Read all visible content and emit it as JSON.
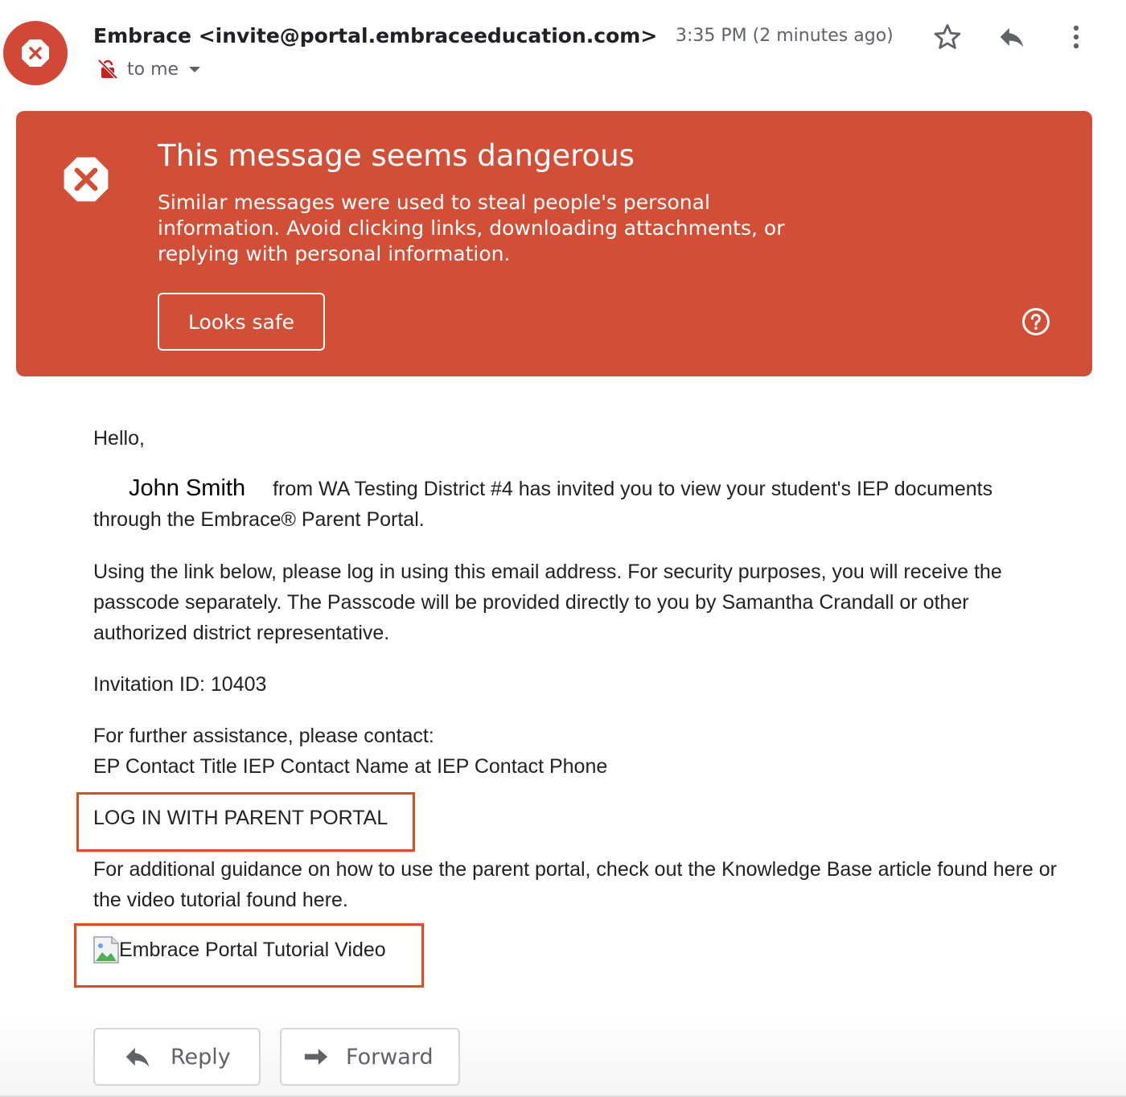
{
  "email": {
    "sender": "Embrace <invite@portal.embraceeducation.com>",
    "recipient": "to me",
    "timestamp": "3:35 PM (2 minutes ago)"
  },
  "warning": {
    "title": "This message seems dangerous",
    "body": "Similar messages were used to steal people's personal information. Avoid clicking links, downloading attachments, or replying with personal information.",
    "button": "Looks safe",
    "background_color": "#d14f37"
  },
  "body": {
    "greeting": "Hello,",
    "invite_name": "John Smith",
    "invite_text": "from WA Testing District #4 has invited you to view your student's IEP documents through the Embrace® Parent Portal.",
    "instructions": "Using the link below, please log in using this email address. For security purposes, you will receive the passcode separately. The Passcode will be provided directly to you by Samantha Crandall or other authorized district representative.",
    "invitation_id": "Invitation ID: 10403",
    "assistance_line1": "For further assistance, please contact:",
    "assistance_line2": "EP Contact Title IEP Contact Name at IEP Contact Phone",
    "portal_link": "LOG IN WITH PARENT PORTAL",
    "guidance": "For additional guidance on how to use the parent portal, check out the Knowledge Base article found here or the video tutorial found here.",
    "video_alt": "Embrace Portal Tutorial Video"
  },
  "actions": {
    "reply": "Reply",
    "forward": "Forward"
  },
  "colors": {
    "highlight_box": "#e8461c",
    "avatar": "#d14836"
  },
  "icons": [
    "danger-icon",
    "no-encryption-icon",
    "chevron-down-icon",
    "star-icon",
    "reply-icon",
    "more-vert-icon",
    "help-icon",
    "broken-image-icon",
    "forward-icon"
  ]
}
